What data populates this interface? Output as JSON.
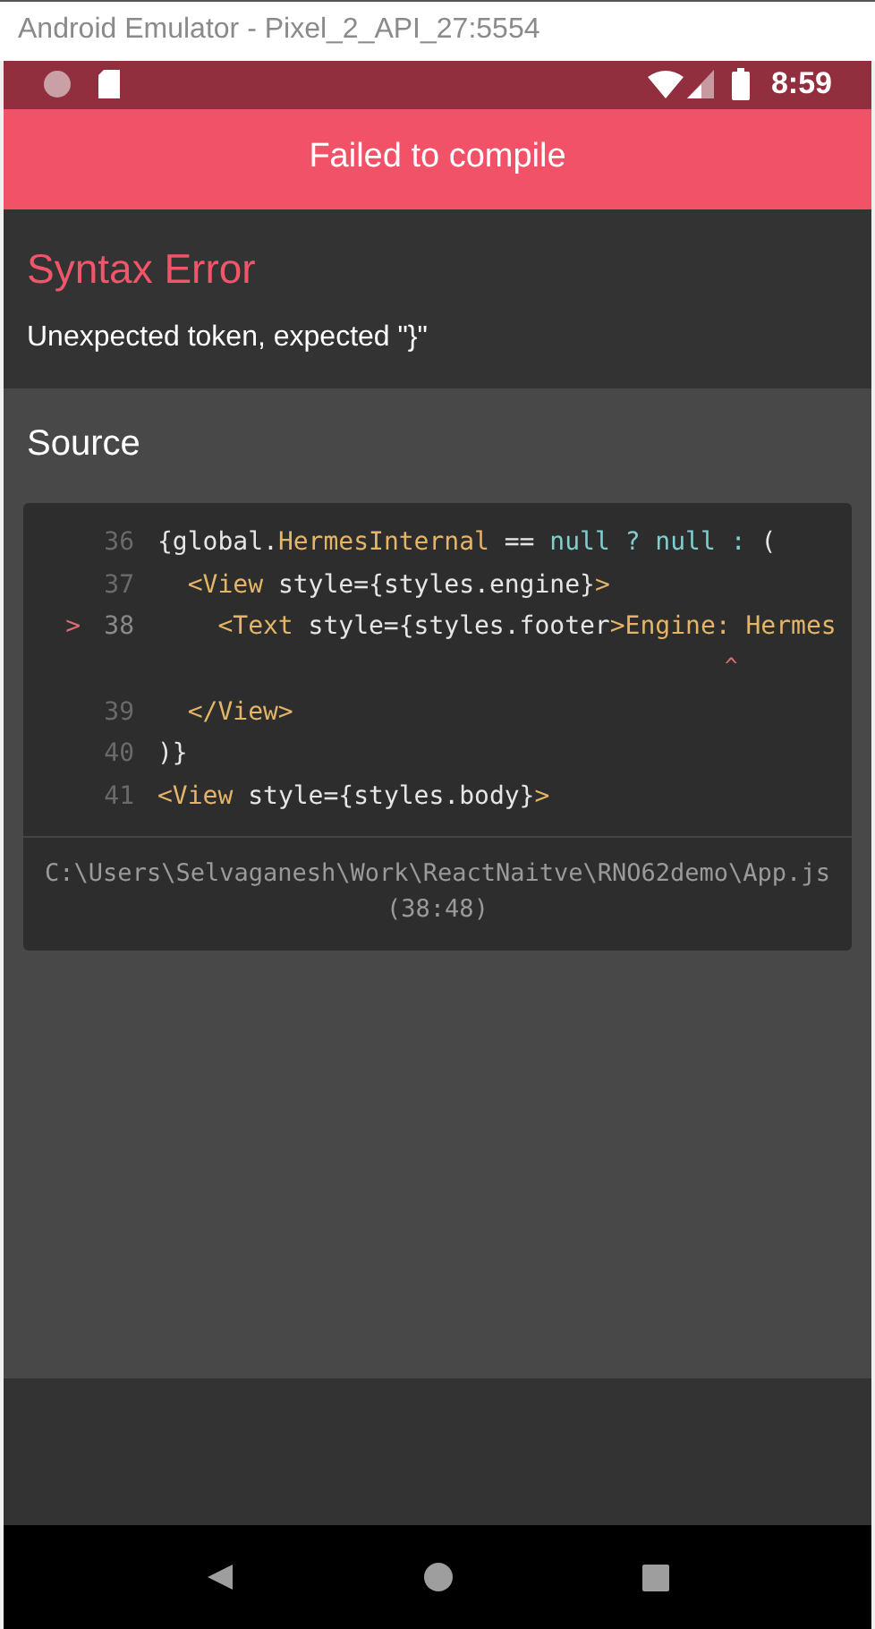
{
  "window": {
    "title": "Android Emulator - Pixel_2_API_27:5554"
  },
  "status_bar": {
    "time": "8:59"
  },
  "header": {
    "title": "Failed to compile"
  },
  "error": {
    "title": "Syntax Error",
    "message": "Unexpected token, expected \"}\""
  },
  "source": {
    "title": "Source",
    "lines": [
      {
        "kind": "code",
        "number": "36",
        "highlighted": false,
        "tokens": [
          {
            "kind": "text",
            "text": "{global."
          },
          {
            "kind": "tag",
            "text": "HermesInternal"
          },
          {
            "kind": "text",
            "text": " == "
          },
          {
            "kind": "keyword",
            "text": "null ? null : "
          },
          {
            "kind": "text",
            "text": "("
          }
        ]
      },
      {
        "kind": "code",
        "number": "37",
        "highlighted": false,
        "tokens": [
          {
            "kind": "tag",
            "text": "  <View"
          },
          {
            "kind": "text",
            "text": " style={styles.engine}"
          },
          {
            "kind": "tag",
            "text": ">"
          }
        ]
      },
      {
        "kind": "code",
        "number": "38",
        "highlighted": true,
        "marker": ">",
        "tokens": [
          {
            "kind": "tag",
            "text": "    <Text"
          },
          {
            "kind": "text",
            "text": " style={styles.footer"
          },
          {
            "kind": "tag",
            "text": ">Engine: Hermes"
          }
        ]
      },
      {
        "kind": "caret",
        "text": "^"
      },
      {
        "kind": "code",
        "number": "39",
        "highlighted": false,
        "tokens": [
          {
            "kind": "tag",
            "text": "  </View>"
          }
        ]
      },
      {
        "kind": "code",
        "number": "40",
        "highlighted": false,
        "tokens": [
          {
            "kind": "text",
            "text": ")}"
          }
        ]
      },
      {
        "kind": "code",
        "number": "41",
        "highlighted": false,
        "tokens": [
          {
            "kind": "tag",
            "text": "<View"
          },
          {
            "kind": "text",
            "text": " style={styles.body}"
          },
          {
            "kind": "tag",
            "text": ">"
          }
        ]
      }
    ],
    "file": "C:\\Users\\Selvaganesh\\Work\\ReactNaitve\\RNO62demo\\App.js",
    "position": "(38:48)"
  }
}
